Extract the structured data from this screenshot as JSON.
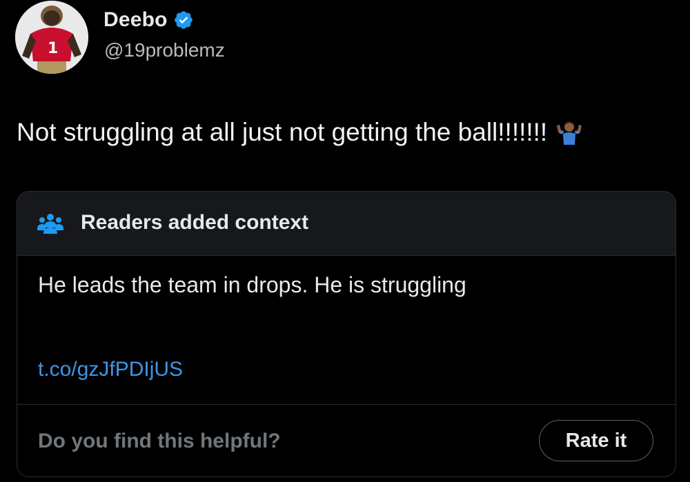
{
  "author": {
    "name": "Deebo",
    "handle": "@19problemz",
    "verified_color": "#1d9bf0"
  },
  "tweet": {
    "text": "Not struggling at all just not getting the ball!!!!!!!",
    "emoji": "🤷🏾‍♂️"
  },
  "community_note": {
    "title": "Readers added context",
    "icon": "readers-group-icon",
    "body": "He leads the team in drops. He is struggling",
    "link": "t.co/gzJfPDIjUS",
    "link_color": "#3e95e8",
    "helpful_question": "Do you find this helpful?",
    "rate_label": "Rate it"
  },
  "colors": {
    "background": "#000000",
    "header_background": "#16181c",
    "border": "#2a2d31",
    "accent": "#1d9bf0"
  }
}
